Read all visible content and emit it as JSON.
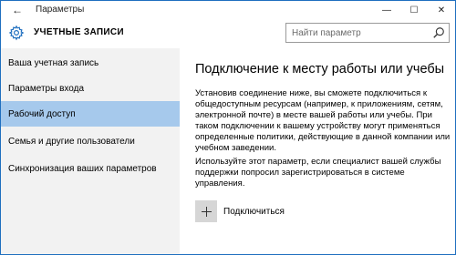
{
  "window": {
    "title": "Параметры",
    "back_glyph": "←",
    "controls": {
      "minimize": "—",
      "maximize": "☐",
      "close": "✕"
    }
  },
  "header": {
    "title": "УЧЕТНЫЕ ЗАПИСИ",
    "search_placeholder": "Найти параметр",
    "icons": {
      "settings": "gear-icon",
      "search": "search-icon"
    }
  },
  "sidebar": {
    "items": [
      {
        "label": "Ваша учетная запись",
        "active": false
      },
      {
        "label": "Параметры входа",
        "active": false
      },
      {
        "label": "Рабочий доступ",
        "active": true
      },
      {
        "label": "Семья и другие пользователи",
        "active": false
      },
      {
        "label": "Синхронизация ваших параметров",
        "active": false
      }
    ]
  },
  "main": {
    "title": "Подключение к месту работы или учебы",
    "paragraph1": "Установив соединение ниже, вы сможете подключиться к общедоступным ресурсам (например, к приложениям, сетям, электронной почте) в месте вашей работы или учебы. При таком подключении к вашему устройству могут применяться определенные политики, действующие в данной компании или учебном заведении.",
    "paragraph2": "Используйте этот параметр, если специалист вашей службы поддержки попросил зарегистрироваться в системе управления.",
    "connect_label": "Подключиться",
    "connect_icon": "plus-icon"
  },
  "colors": {
    "accent": "#1f6fbf",
    "sidebar_bg": "#f2f2f2",
    "selected_bg": "#a6c9ec",
    "plus_tile": "#d6d6d6"
  }
}
